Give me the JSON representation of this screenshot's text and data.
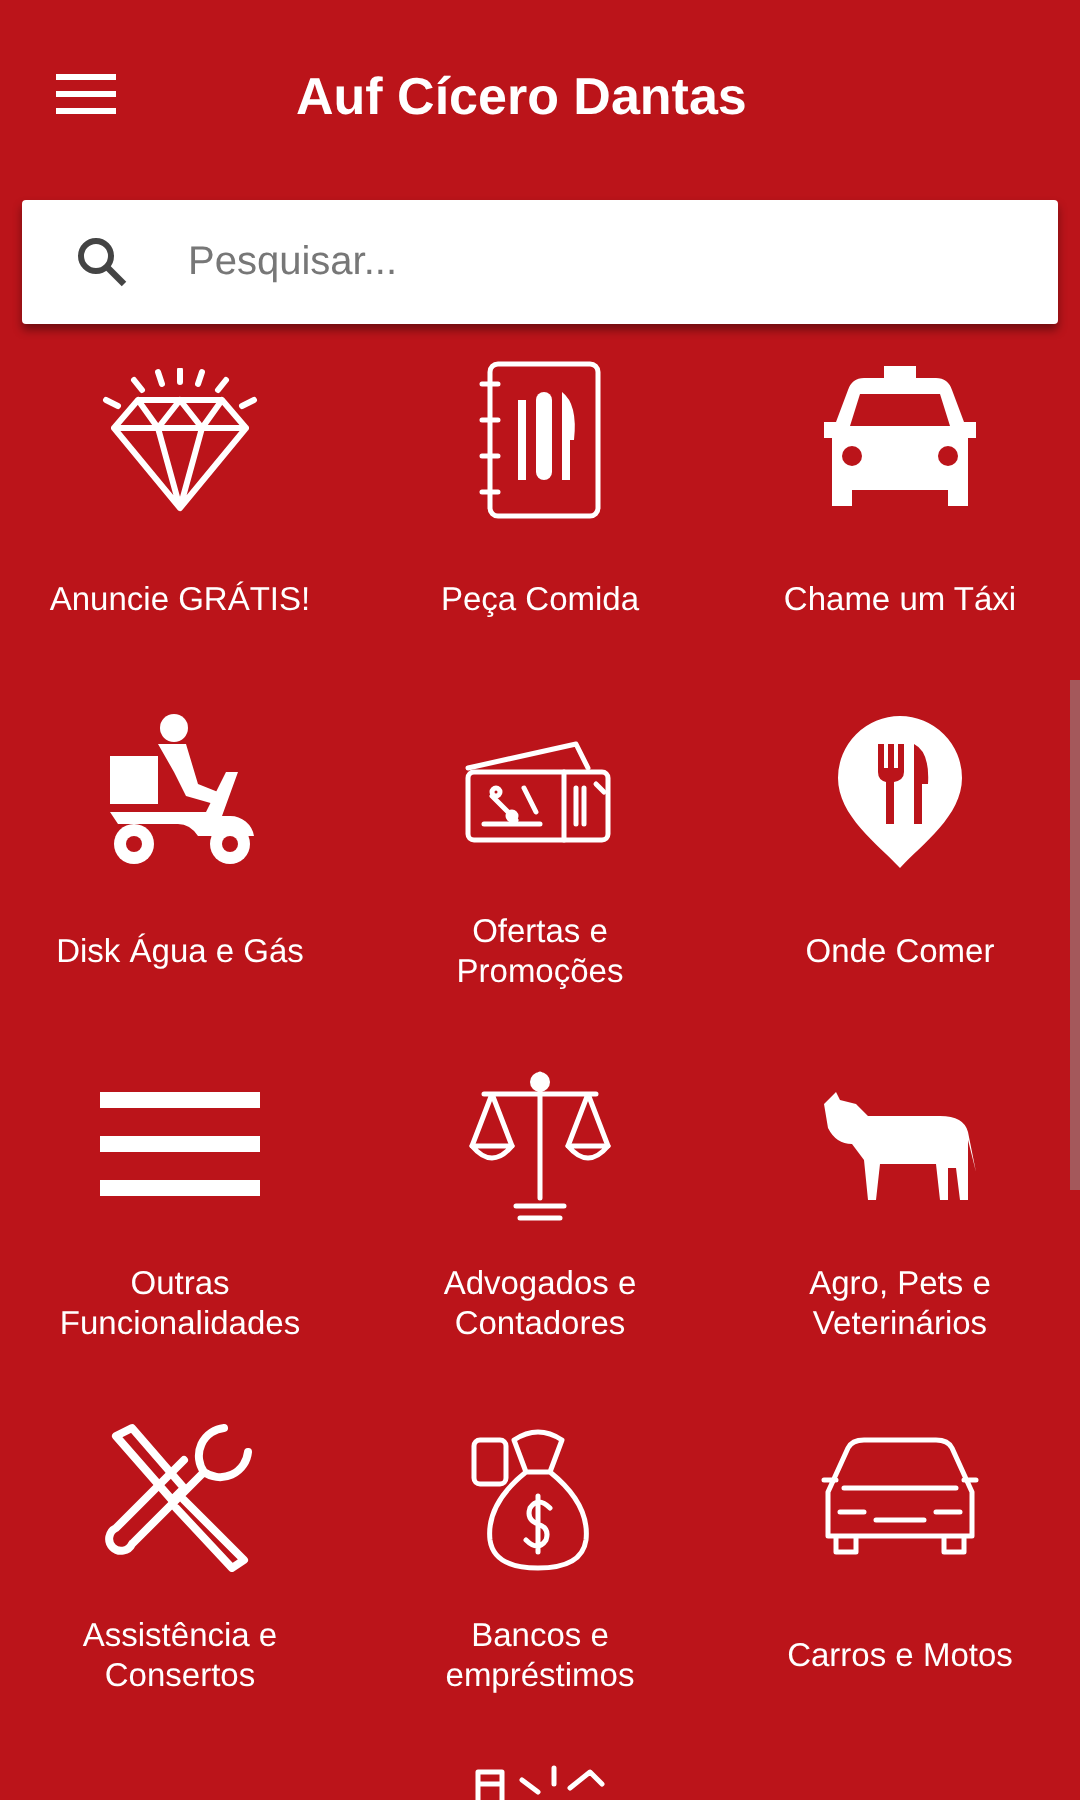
{
  "app_bar": {
    "title": "Auf Cícero Dantas"
  },
  "search": {
    "placeholder": "Pesquisar..."
  },
  "categories": [
    {
      "label": "Anuncie GRÁTIS!"
    },
    {
      "label": "Peça Comida"
    },
    {
      "label": "Chame um Táxi"
    },
    {
      "label": "Disk Água e Gás"
    },
    {
      "label": "Ofertas e Promoções"
    },
    {
      "label": "Onde Comer"
    },
    {
      "label": "Outras Funcionalidades"
    },
    {
      "label": "Advogados e Contadores"
    },
    {
      "label": "Agro, Pets e Veterinários"
    },
    {
      "label": "Assistência e Consertos"
    },
    {
      "label": "Bancos e empréstimos"
    },
    {
      "label": "Carros e Motos"
    }
  ]
}
